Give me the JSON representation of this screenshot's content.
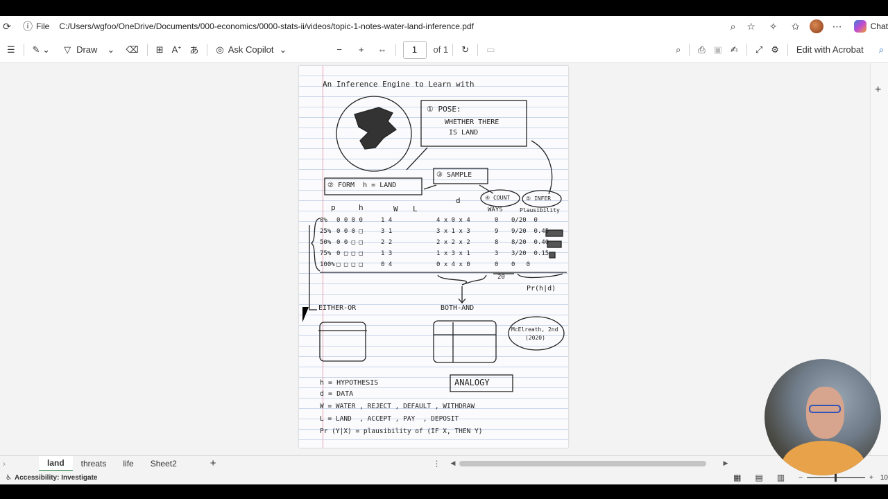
{
  "address": {
    "label": "File",
    "path": "C:/Users/wgfoo/OneDrive/Documents/000-economics/0000-stats-ii/videos/topic-1-notes-water-land-inference.pdf",
    "chat_label": "Chat"
  },
  "toolbar": {
    "draw_label": "Draw",
    "copilot_label": "Ask Copilot",
    "page_current": "1",
    "page_total": "of 1",
    "acrobat_label": "Edit with Acrobat"
  },
  "notes": {
    "title": "An Inference Engine to Learn with",
    "pose_1": "① POSE:",
    "pose_2": "WHETHER THERE",
    "pose_3": "IS LAND",
    "sample": "③ SAMPLE",
    "form": "② FORM  h = LAND",
    "count": "④ COUNT",
    "infer": "⑤ INFER",
    "col_p": "p",
    "col_h": "h",
    "col_w": "W",
    "col_l": "L",
    "col_d": "d",
    "col_ways": "WAYS",
    "col_plaus": "Plausibility",
    "rows": [
      {
        "p": "0%",
        "h": "0 0 0 0",
        "wl": "1 4",
        "d": "4 x 0 x 4",
        "ways": "0",
        "pl": "0/20  0"
      },
      {
        "p": "25%",
        "h": "0 0 0 □",
        "wl": "3 1",
        "d": "3 x 1 x 3",
        "ways": "9",
        "pl": "9/20  0.45"
      },
      {
        "p": "50%",
        "h": "0 0 □ □",
        "wl": "2 2",
        "d": "2 x 2 x 2",
        "ways": "8",
        "pl": "8/20  0.40"
      },
      {
        "p": "75%",
        "h": "0 □ □ □",
        "wl": "1 3",
        "d": "1 x 3 x 1",
        "ways": "3",
        "pl": "3/20  0.15"
      },
      {
        "p": "100%",
        "h": "□ □ □ □",
        "wl": "0 4",
        "d": "0 x 4 x 0",
        "ways": "0",
        "pl": "0   0"
      }
    ],
    "ways_total": "20",
    "prhd": "Pr(h|d)",
    "either_or": "EITHER-OR",
    "both_and": "BOTH-AND",
    "mcelreath_1": "McElreath, 2nd",
    "mcelreath_2": "(2020)",
    "analogy": "ANALOGY",
    "def_1": "h = HYPOTHESIS",
    "def_2": "d = DATA",
    "def_3": "W = WATER , REJECT , DEFAULT , WITHDRAW",
    "def_4": "L = LAND  , ACCEPT , PAY  , DEPOSIT",
    "def_5": "Pr (Y|X) = plausibility of (IF X, THEN Y)"
  },
  "sheets": {
    "tabs": [
      "land",
      "threats",
      "life",
      "Sheet2"
    ],
    "add_label": "+"
  },
  "status": {
    "accessibility": "Accessibility: Investigate",
    "zoom": "10"
  },
  "colors": {
    "sheet_accent": "#1b7f3b",
    "notebook_rule": "#c9d6ea",
    "margin_red": "#e8a0a8"
  }
}
